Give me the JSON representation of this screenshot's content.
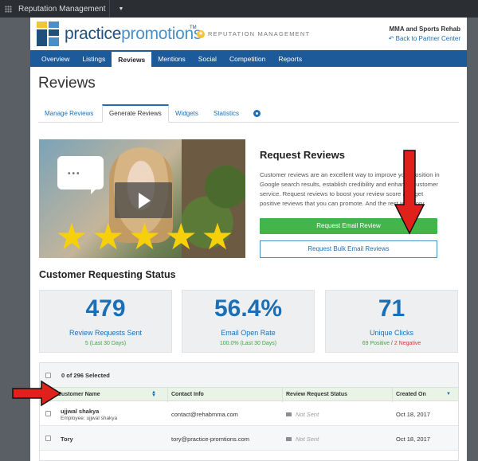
{
  "topbar": {
    "app_name": "Reputation Management"
  },
  "header": {
    "logo_part1": "practice",
    "logo_part2": "promotions",
    "logo_tm": "TM",
    "section_label": "REPUTATION MANAGEMENT",
    "business_name": "MMA and Sports Rehab",
    "back_link": "Back to Partner Center"
  },
  "nav": {
    "items": [
      {
        "label": "Overview"
      },
      {
        "label": "Listings"
      },
      {
        "label": "Reviews"
      },
      {
        "label": "Mentions"
      },
      {
        "label": "Social"
      },
      {
        "label": "Competition"
      },
      {
        "label": "Reports"
      }
    ],
    "active": "Reviews"
  },
  "page": {
    "title": "Reviews"
  },
  "subtabs": [
    {
      "label": "Manage Reviews"
    },
    {
      "label": "Generate Reviews"
    },
    {
      "label": "Widgets"
    },
    {
      "label": "Statistics"
    }
  ],
  "request": {
    "title": "Request Reviews",
    "description": "Customer reviews are an excellent way to improve your position in Google search results, establish credibility and enhance customer service. Request reviews to boost your review score and get positive reviews that you can promote. And the rest is history.",
    "email_button": "Request Email Review",
    "bulk_button": "Request Bulk Email Reviews"
  },
  "status": {
    "title": "Customer Requesting Status",
    "cards": [
      {
        "value": "479",
        "label": "Review Requests Sent",
        "sub": "5 (Last 30 Days)"
      },
      {
        "value": "56.4%",
        "label": "Email Open Rate",
        "sub": "100.0% (Last 30 Days)"
      },
      {
        "value": "71",
        "label": "Unique Clicks",
        "sub_positive": "69 Positive",
        "sub_sep": " / ",
        "sub_negative": "2 Negative"
      }
    ]
  },
  "table": {
    "selected_text": "0 of 296 Selected",
    "headers": [
      "Customer Name",
      "Contact Info",
      "Review Request Status",
      "Created On"
    ],
    "rows": [
      {
        "name": "ujjwal shakya",
        "sub": "Employee: ujjwal shakya",
        "contact": "contact@rehabmma.com",
        "status": "Not Sent",
        "created": "Oct 18, 2017"
      },
      {
        "name": "Tory",
        "sub": "",
        "contact": "tory@practice-promtions.com",
        "status": "Not Sent",
        "created": "Oct 18, 2017"
      }
    ]
  },
  "colors": {
    "nav": "#1c5a99",
    "accent": "#1c6fb5",
    "green": "#43b54a",
    "annotation_arrow": "#e0201b"
  }
}
